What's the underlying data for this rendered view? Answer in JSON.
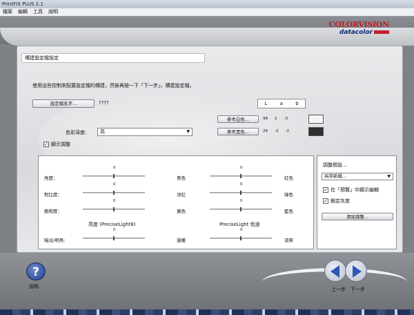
{
  "window": {
    "title": "PrintFIX PLUS 2.1"
  },
  "menu": [
    "檔案",
    "編輯",
    "工具",
    "說明"
  ],
  "logo": {
    "top": "COLORVISION",
    "bottom": "datacolor"
  },
  "panel": {
    "title": "構建設定檔設定",
    "instruction": "使用這些控制來配置設定檔的構建，然後再按一下「下一步」，構建設定檔。",
    "profile_name_button": "設定檔名字...",
    "profile_name_value": "????",
    "lab": {
      "headers": [
        "L",
        "a",
        "b"
      ]
    },
    "ref_white": {
      "label": "參考白色...",
      "values": [
        "98",
        "2",
        "-3"
      ]
    },
    "ref_black": {
      "label": "參考黑色...",
      "values": [
        "26",
        "-2",
        "-2"
      ]
    },
    "color_depth": {
      "label": "色彩深度:",
      "selected": "高"
    },
    "show_adjust": {
      "label": "顯示調整",
      "checked": true
    }
  },
  "adjust": {
    "sliders": [
      {
        "left": "亮度：",
        "right": "",
        "value": "0"
      },
      {
        "left": "對比度：",
        "right": "",
        "value": "0"
      },
      {
        "left": "飽和度：",
        "right": "",
        "value": "0"
      }
    ],
    "color_sliders": [
      {
        "left": "青色",
        "right": "紅色",
        "value": "0"
      },
      {
        "left": "洋紅",
        "right": "綠色",
        "value": "0"
      },
      {
        "left": "黃色",
        "right": "藍色",
        "value": "0"
      }
    ],
    "pl8_head": "亮度 (PreciseLight8)",
    "pl_color_head": "PreciseLight 色過",
    "bottom_left": {
      "label": "暗淡/明亮:",
      "value": "0"
    },
    "bottom_right": {
      "left": "過暖",
      "right": "涼爽",
      "value": "0"
    }
  },
  "side": {
    "title": "調整預設...",
    "select": "另存新檔...",
    "preview_check": {
      "label": "在「預覽」中顯示編輯",
      "checked": true
    },
    "gray_check": {
      "label": "鎖定灰度",
      "checked": true
    },
    "clear_button": "清除調整..."
  },
  "footer": {
    "help": "說明",
    "back": "上一步",
    "next": "下一步",
    "help_icon": "question-icon",
    "back_icon": "arrow-left-icon",
    "next_icon": "arrow-right-icon"
  }
}
